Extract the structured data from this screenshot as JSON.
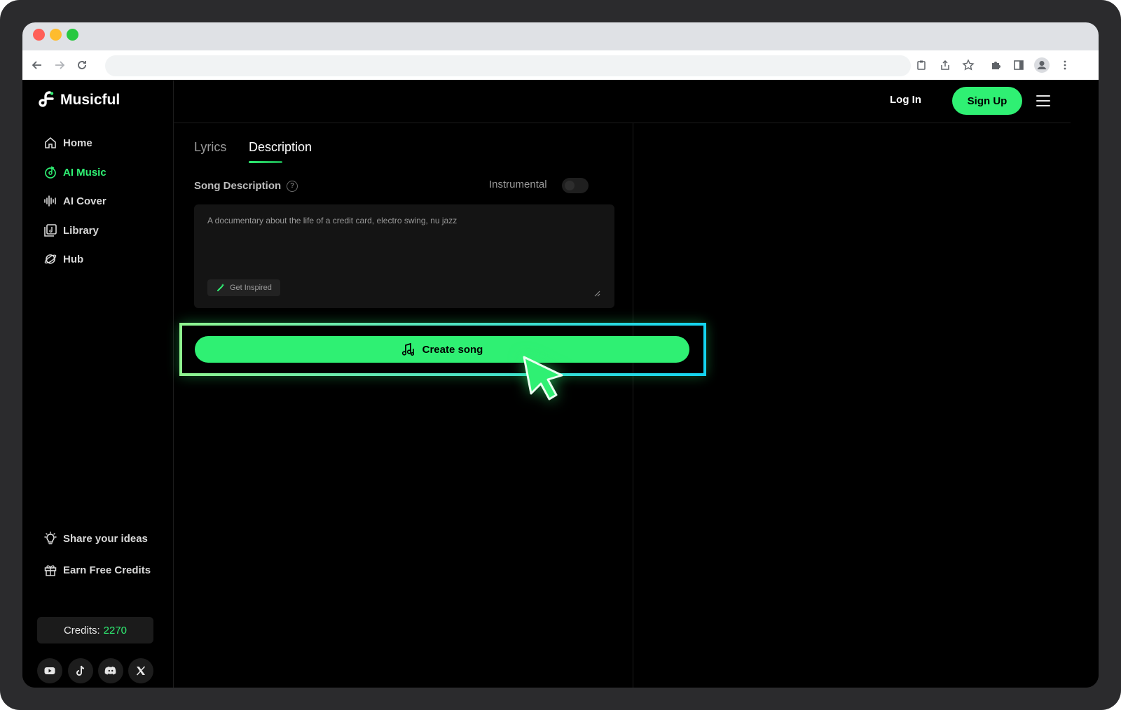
{
  "app": {
    "name": "Musicful"
  },
  "sidebar": {
    "items": [
      {
        "label": "Home",
        "icon": "home-icon",
        "active": false
      },
      {
        "label": "AI Music",
        "icon": "music-disc-icon",
        "active": true
      },
      {
        "label": "AI Cover",
        "icon": "waveform-icon",
        "active": false
      },
      {
        "label": "Library",
        "icon": "library-icon",
        "active": false
      },
      {
        "label": "Hub",
        "icon": "planet-icon",
        "active": false
      }
    ],
    "bottom_items": [
      {
        "label": "Share your ideas",
        "icon": "lightbulb-icon"
      },
      {
        "label": "Earn Free Credits",
        "icon": "gift-icon"
      }
    ],
    "credits": {
      "label": "Credits:",
      "value": "2270"
    },
    "social": [
      "youtube-icon",
      "tiktok-icon",
      "discord-icon",
      "x-icon"
    ]
  },
  "header": {
    "login": "Log In",
    "signup": "Sign Up"
  },
  "tabs": [
    {
      "label": "Lyrics",
      "active": false
    },
    {
      "label": "Description",
      "active": true
    }
  ],
  "form": {
    "label": "Song Description",
    "instrumental_label": "Instrumental",
    "instrumental_on": false,
    "description_value": "A documentary about the life of a credit card, electro swing, nu jazz",
    "get_inspired": "Get Inspired"
  },
  "create_button": "Create song",
  "colors": {
    "accent": "#2ff073",
    "background": "#000000",
    "highlight_end": "#14d4f0"
  }
}
